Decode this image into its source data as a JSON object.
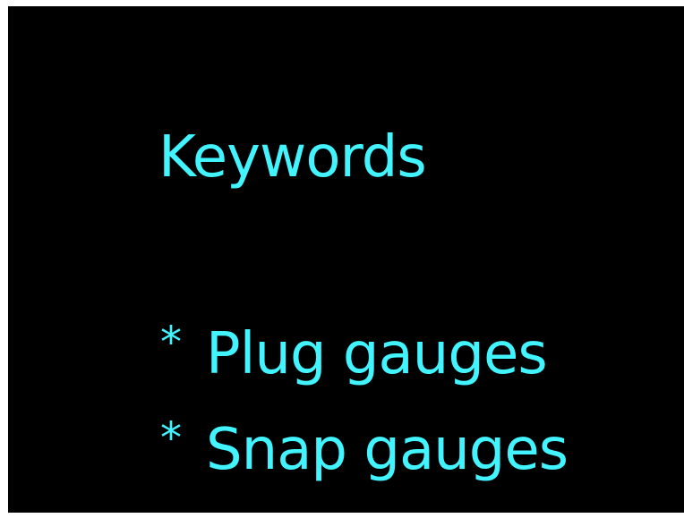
{
  "slide": {
    "title": "Keywords",
    "bullet_marker": "*",
    "bullets": [
      "Plug gauges",
      "Snap gauges"
    ]
  },
  "colors": {
    "background": "#000000",
    "text": "#42f4ff",
    "border": "#ffffff"
  }
}
